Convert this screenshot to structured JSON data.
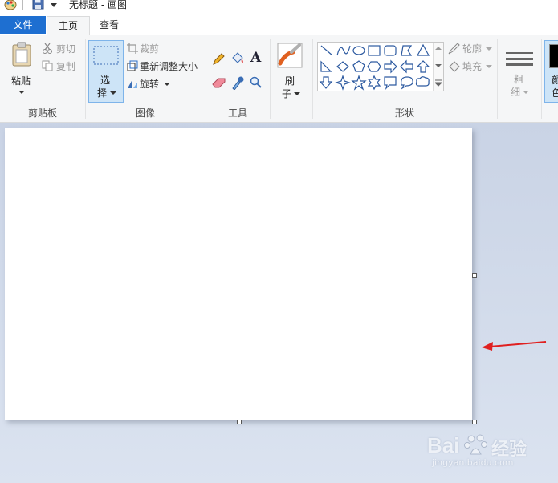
{
  "title_bar": {
    "title": "无标题 - 画图"
  },
  "tabs": {
    "file": "文件",
    "home": "主页",
    "view": "查看"
  },
  "clipboard": {
    "paste": "粘贴",
    "cut": "剪切",
    "copy": "复制",
    "group": "剪贴板"
  },
  "image": {
    "select_1": "选",
    "select_2": "择",
    "crop": "裁剪",
    "resize": "重新调整大小",
    "rotate": "旋转",
    "group": "图像"
  },
  "tools": {
    "group": "工具",
    "text_glyph": "A"
  },
  "brushes": {
    "label_1": "刷",
    "label_2": "子"
  },
  "shapes": {
    "group": "形状",
    "outline": "轮廓",
    "fill": "填充"
  },
  "size": {
    "label_1": "粗",
    "label_2": "细"
  },
  "colors": {
    "label_1": "颜",
    "label_2": "色"
  },
  "watermark": {
    "logo_prefix": "Bai",
    "logo_suffix": "经验",
    "url": "jingyan.baidu.com"
  },
  "accent": {
    "file_tab": "#1e6fd1",
    "arrow": "#e02020",
    "select_active": "#cde4f7"
  }
}
